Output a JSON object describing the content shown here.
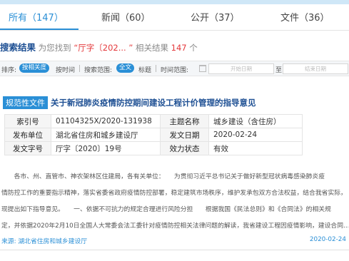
{
  "tabs": [
    {
      "label": "所有（147）",
      "active": true
    },
    {
      "label": "新闻（60）",
      "active": false
    },
    {
      "label": "公开（37）",
      "active": false
    },
    {
      "label": "文件（36）",
      "active": false
    }
  ],
  "search_result": {
    "heading": "搜索结果",
    "prefix": "为您找到",
    "query": "“厅字〔202... ”",
    "count_label": "相关结果",
    "count": "147",
    "count_suffix": "个"
  },
  "filter_bar": {
    "sort_label": "排序:",
    "sort_relevance": "按相关度",
    "sort_time": "按时间",
    "scope_label": "搜索范围:",
    "scope_all": "全文",
    "scope_title": "标题",
    "time_label": "时间范围:",
    "start_placeholder": "开始日期",
    "to": "至",
    "end_placeholder": "结束日期"
  },
  "document": {
    "type_badge": "规范性文件",
    "title": "关于新冠肺炎疫情防控期间建设工程计价管理的指导意见",
    "fields": {
      "index_label": "索引号",
      "index_value": "01104325X/2020-131938",
      "topic_label": "主题名称",
      "topic_value": "城乡建设（含住房）",
      "issuer_label": "发布单位",
      "issuer_value": "湖北省住房和城乡建设厅",
      "date_label": "发文日期",
      "date_value": "2020-02-24",
      "docno_label": "发文字号",
      "docno_value": "厅字〔2020〕19号",
      "status_label": "效力状态",
      "status_value": "有效"
    },
    "abstract_lines": [
      "　　各市、州、直管市、神农架林区住建局，各有关单位：　　为贯彻习近平总书记关于做好新型冠状病毒感染肺炎疫",
      "情防控工作的重要指示精神，落实省委省政府疫情防控部署，稳定建筑市场秩序，维护发承包双方合法权益，结合我省实际，",
      "现提出如下指导意见。　　一、依据不可抗力的规定合理进行风险分担　　根据我国《民法总则》和《合同法》的相关规",
      "定，并依据2020年2月10日全国人大常委会法工委针对疫情防控相关法律问题的解读，我省建设工程因疫情影响，建设合同..."
    ],
    "source": "来源: 湖北省住房和城乡建设厅",
    "date": "2020-02-24"
  },
  "colors": {
    "accent": "#2a8fd6",
    "title_blue": "#1d4f93",
    "highlight_red": "#e4393c",
    "valid_green": "#3aa335"
  }
}
